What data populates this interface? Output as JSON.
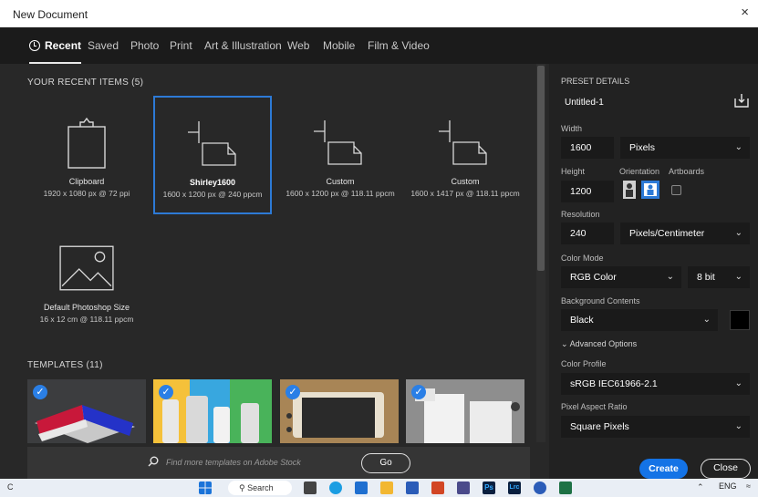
{
  "window": {
    "title": "New Document",
    "close_glyph": "×"
  },
  "tabs": [
    {
      "label": "Recent",
      "active": true
    },
    {
      "label": "Saved"
    },
    {
      "label": "Photo"
    },
    {
      "label": "Print"
    },
    {
      "label": "Art & Illustration"
    },
    {
      "label": "Web"
    },
    {
      "label": "Mobile"
    },
    {
      "label": "Film & Video"
    }
  ],
  "recent": {
    "title": "YOUR RECENT ITEMS  (5)",
    "items": [
      {
        "name": "Clipboard",
        "meta": "1920 x 1080 px @ 72 ppi",
        "icon": "clipboard-icon"
      },
      {
        "name": "Shirley1600",
        "meta": "1600 x 1200 px @ 240 ppcm",
        "icon": "document-icon",
        "selected": true
      },
      {
        "name": "Custom",
        "meta": "1600 x 1200 px @ 118.11 ppcm",
        "icon": "document-icon"
      },
      {
        "name": "Custom",
        "meta": "1600 x 1417 px @ 118.11 ppcm",
        "icon": "document-icon"
      },
      {
        "name": "Default Photoshop Size",
        "meta": "16 x 12 cm @ 118.11 ppcm",
        "icon": "image-icon"
      }
    ]
  },
  "templates": {
    "title": "TEMPLATES  (11)",
    "check_glyph": "✓"
  },
  "stock_search": {
    "placeholder": "Find more templates on Adobe Stock",
    "go_label": "Go"
  },
  "preset": {
    "header": "PRESET DETAILS",
    "name": "Untitled-1",
    "width_label": "Width",
    "width": "1600",
    "width_unit": "Pixels",
    "height_label": "Height",
    "height": "1200",
    "orientation_label": "Orientation",
    "artboards_label": "Artboards",
    "resolution_label": "Resolution",
    "resolution": "240",
    "resolution_unit": "Pixels/Centimeter",
    "color_mode_label": "Color Mode",
    "color_mode": "RGB Color",
    "bit_depth": "8 bit",
    "background_label": "Background Contents",
    "background": "Black",
    "background_color": "#000000",
    "advanced_label": "Advanced Options",
    "color_profile_label": "Color Profile",
    "color_profile": "sRGB IEC61966-2.1",
    "pixel_aspect_label": "Pixel Aspect Ratio",
    "pixel_aspect": "Square Pixels",
    "create_label": "Create",
    "close_label": "Close"
  },
  "taskbar": {
    "search_label": "Search",
    "language": "ENG",
    "left_text": "C",
    "ps_label": "Ps",
    "lrc_label": "Lrc"
  },
  "colors": {
    "accent": "#1473e6",
    "selection": "#2d7ad6"
  }
}
